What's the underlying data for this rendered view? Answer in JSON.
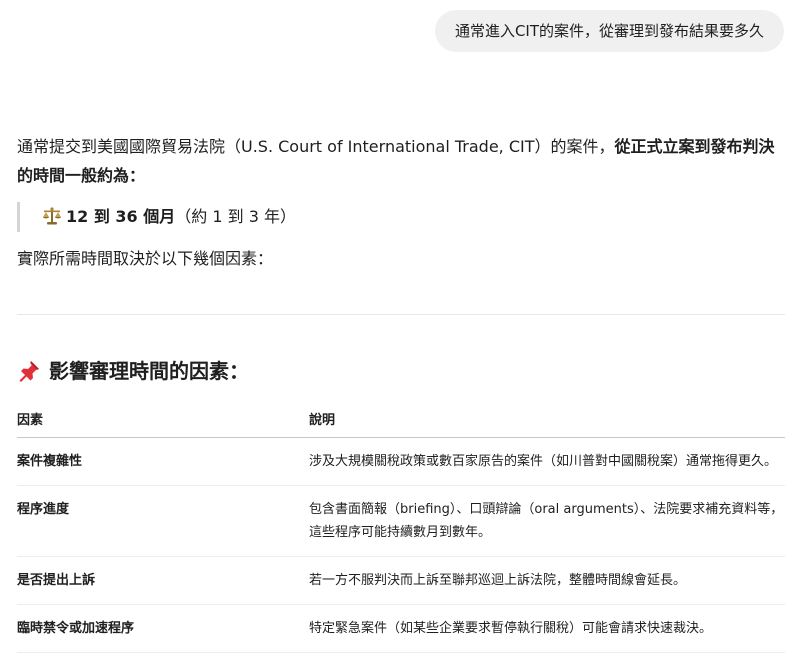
{
  "user_message": "通常進入CIT的案件，從審理到發布結果要多久",
  "answer": {
    "intro_prefix": "通常提交到美國國際貿易法院（U.S. Court of International Trade, CIT）的案件，",
    "intro_bold": "從正式立案到發布判決的時間一般約為：",
    "quote_icon": "scales-icon",
    "quote_bold": "12 到 36 個月",
    "quote_rest": "（約 1 到 3 年）",
    "factors_note": "實際所需時間取決於以下幾個因素："
  },
  "section": {
    "icon": "pushpin-icon",
    "heading": "影響審理時間的因素："
  },
  "table": {
    "headers": [
      "因素",
      "說明"
    ],
    "rows": [
      {
        "factor": "案件複雜性",
        "description": "涉及大規模關稅政策或數百家原告的案件（如川普對中國關稅案）通常拖得更久。"
      },
      {
        "factor": "程序進度",
        "description": "包含書面簡報（briefing）、口頭辯論（oral arguments）、法院要求補充資料等，這些程序可能持續數月到數年。"
      },
      {
        "factor": "是否提出上訴",
        "description": "若一方不服判決而上訴至聯邦巡迴上訴法院，整體時間線會延長。"
      },
      {
        "factor": "臨時禁令或加速程序",
        "description": "特定緊急案件（如某些企業要求暫停執行關稅）可能會請求快速裁決。"
      }
    ]
  },
  "colors": {
    "bubble_bg": "#f0f0f0",
    "text": "#1f1f1f",
    "pin_red": "#e0313b"
  }
}
